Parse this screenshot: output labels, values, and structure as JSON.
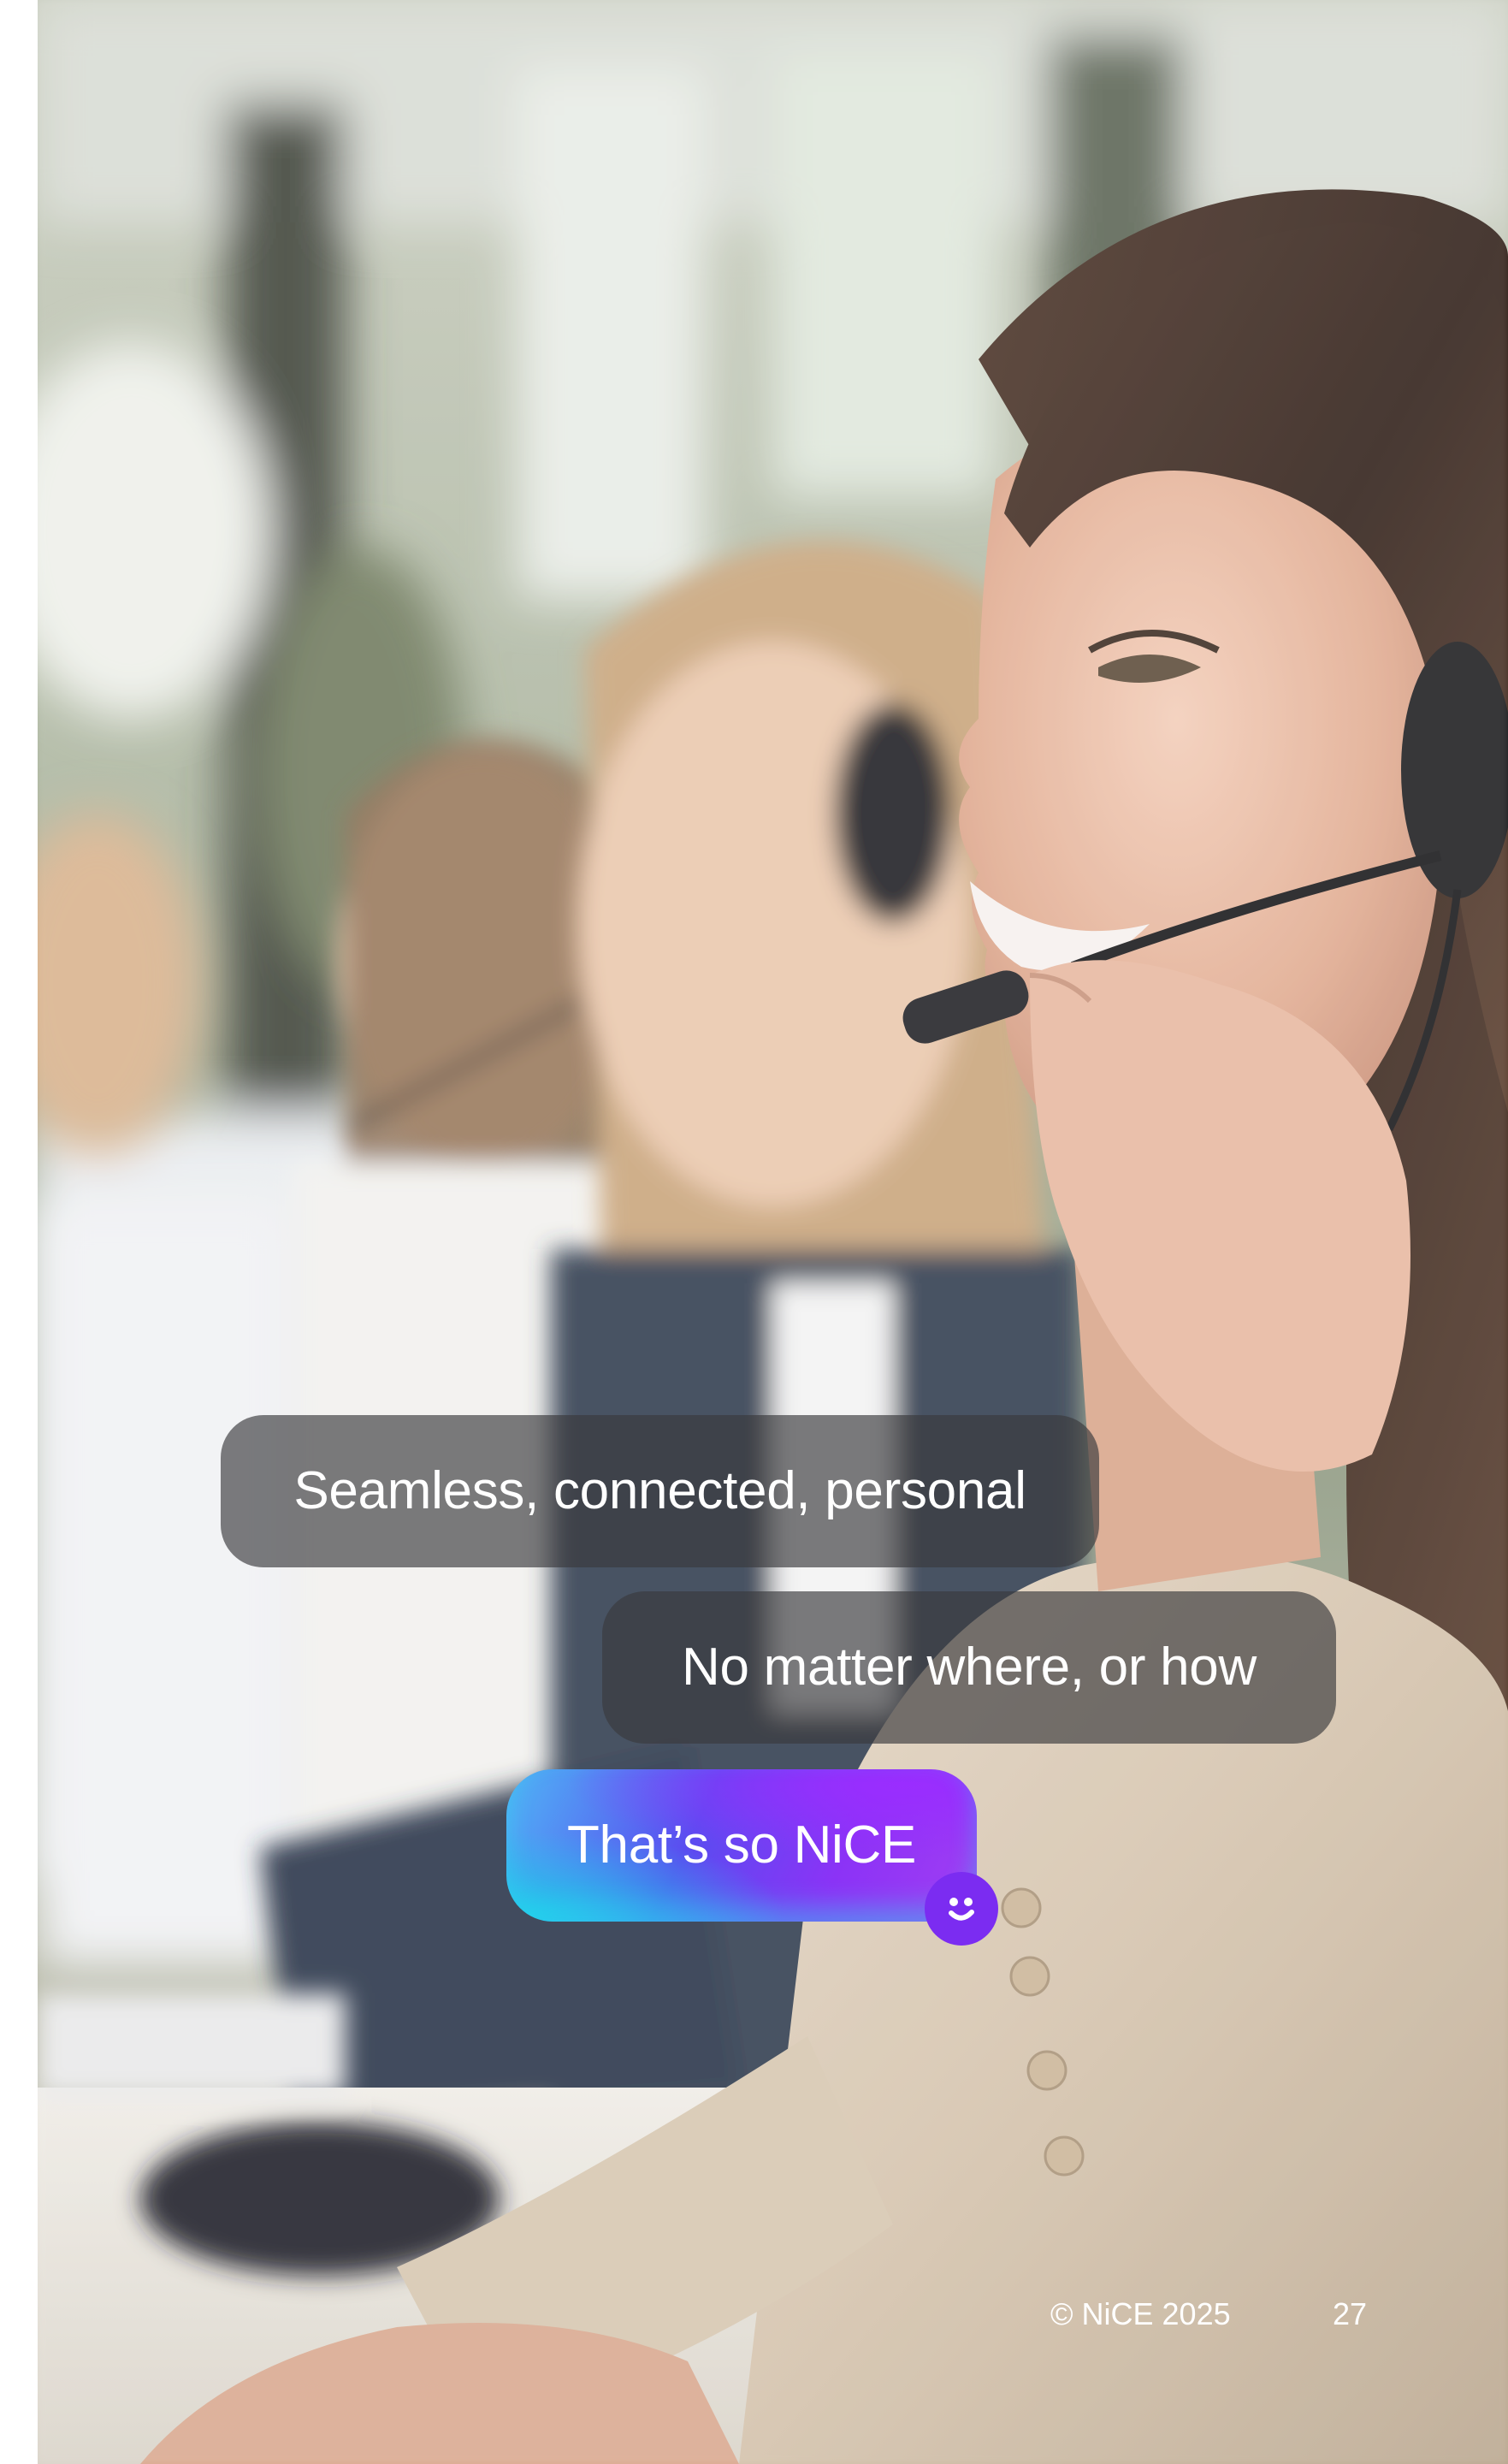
{
  "page": {
    "background_color": "#ffffff"
  },
  "photo": {
    "icon": "contact-center-agents-photo"
  },
  "chat": {
    "bubble_1": "Seamless, connected, personal",
    "bubble_2": "No matter where, or how",
    "bubble_3": "That’s so NiCE",
    "bubble_grey_color": "#3a3a3c",
    "bubble_gradient_colors": [
      "#23c6ea",
      "#5a4cf0",
      "#9a2dff"
    ],
    "badge_icon": "smile-icon",
    "badge_color": "#7b2cf1"
  },
  "footer": {
    "copyright": "© NiCE 2025",
    "page_number": "27"
  }
}
